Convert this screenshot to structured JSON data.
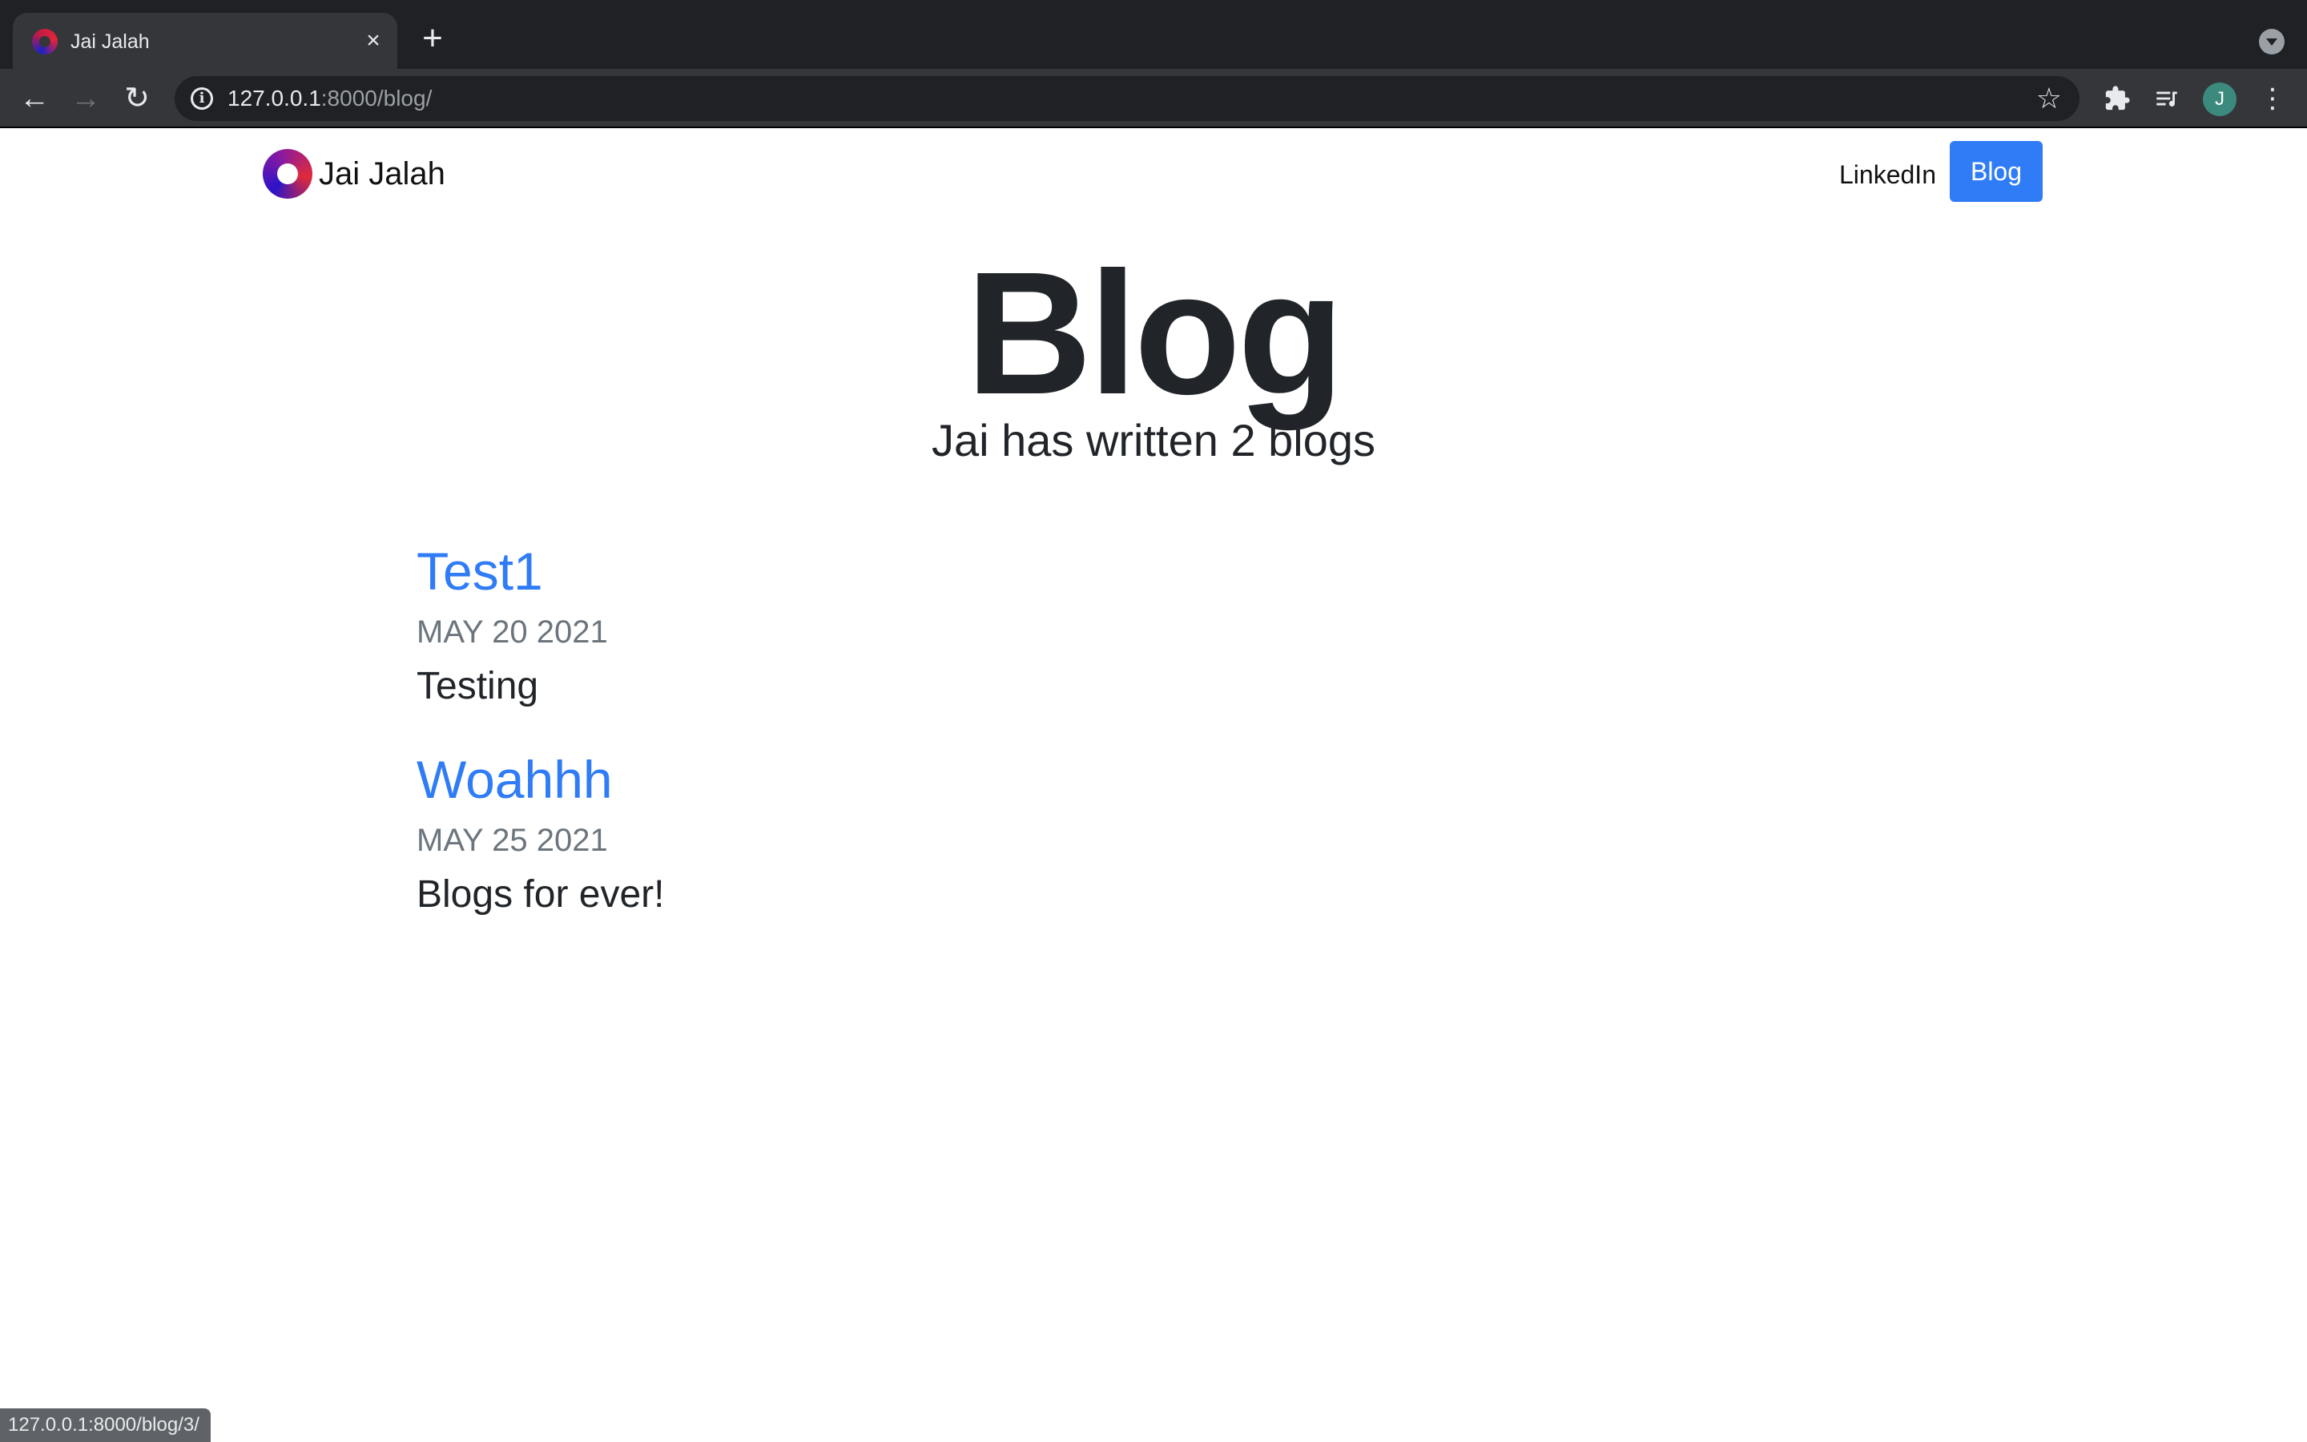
{
  "browser": {
    "tab_title": "Jai Jalah",
    "tab_close_glyph": "×",
    "new_tab_glyph": "+",
    "url_host": "127.0.0.1",
    "url_path": ":8000/blog/",
    "profile_initial": "J",
    "status_url": "127.0.0.1:8000/blog/3/"
  },
  "navbar": {
    "brand_name": "Jai Jalah",
    "links": [
      "LinkedIn",
      "Blog"
    ],
    "active_color": "#2f7cf6"
  },
  "header": {
    "title": "Blog",
    "subtitle": "Jai has written 2 blogs"
  },
  "posts": [
    {
      "title": "Test1",
      "date": "MAY 20 2021",
      "body": "Testing"
    },
    {
      "title": "Woahhh",
      "date": "MAY 25 2021",
      "body": "Blogs for ever!"
    }
  ],
  "colors": {
    "link": "#2f7cf6",
    "date": "#6c757d",
    "text": "#212529"
  }
}
